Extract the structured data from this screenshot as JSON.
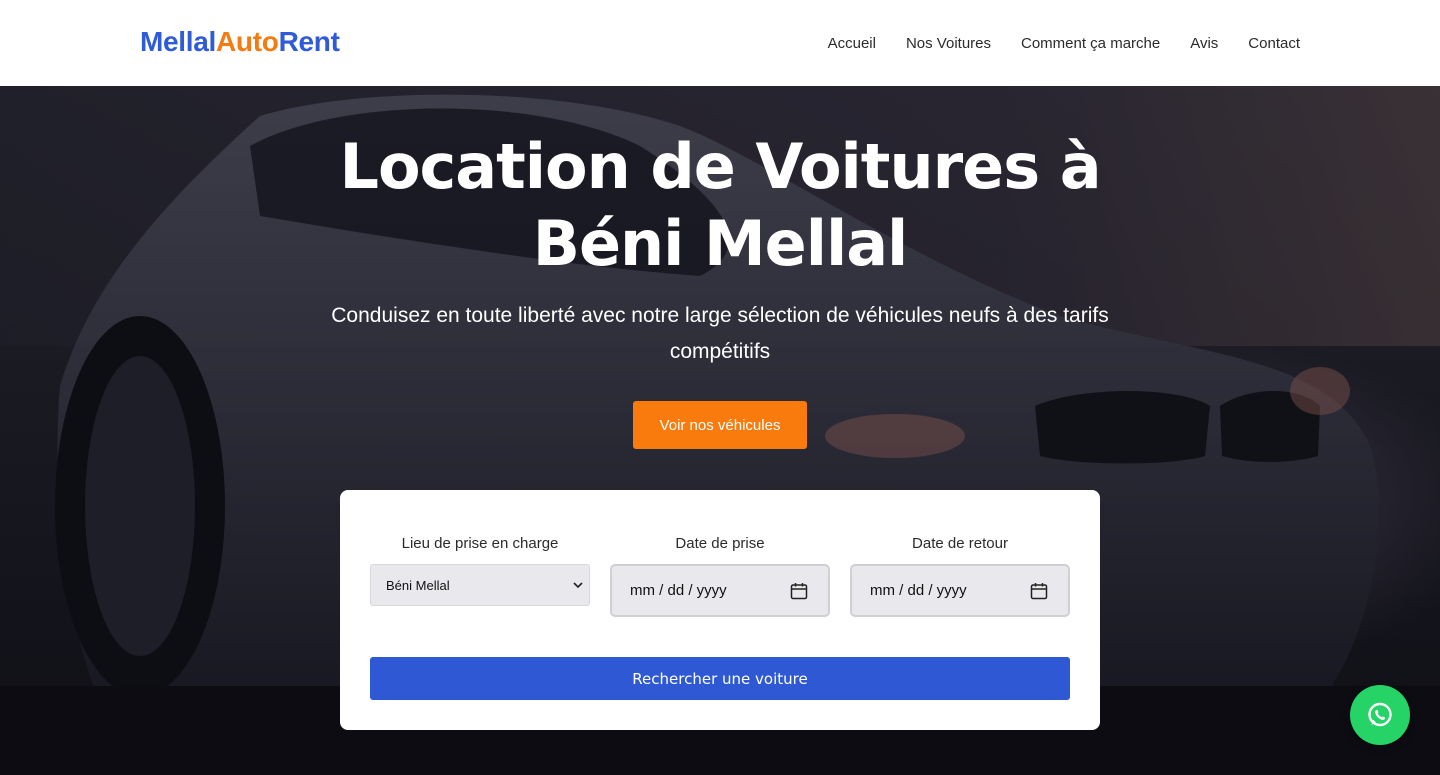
{
  "header": {
    "logo": {
      "part1": "Mellal",
      "part2": "Auto",
      "part3": "Rent"
    },
    "nav": [
      {
        "label": "Accueil"
      },
      {
        "label": "Nos Voitures"
      },
      {
        "label": "Comment ça marche"
      },
      {
        "label": "Avis"
      },
      {
        "label": "Contact"
      }
    ]
  },
  "hero": {
    "title_line1": "Location de Voitures à",
    "title_line2": "Béni Mellal",
    "subtitle": "Conduisez en toute liberté avec notre large sélection de véhicules neufs à des tarifs compétitifs",
    "cta_label": "Voir nos véhicules"
  },
  "search": {
    "location_label": "Lieu de prise en charge",
    "location_value": "Béni Mellal",
    "pickup_label": "Date de prise",
    "pickup_placeholder": "mm / dd / yyyy",
    "return_label": "Date de retour",
    "return_placeholder": "mm / dd / yyyy",
    "submit_label": "Rechercher une voiture"
  },
  "colors": {
    "brand_blue": "#2f5bd8",
    "brand_orange": "#f47a12",
    "cta_orange": "#f97b0e",
    "search_blue": "#2f58d4",
    "whatsapp_green": "#25d366"
  },
  "icons": [
    "chevron-down-icon",
    "calendar-icon",
    "whatsapp-icon"
  ]
}
